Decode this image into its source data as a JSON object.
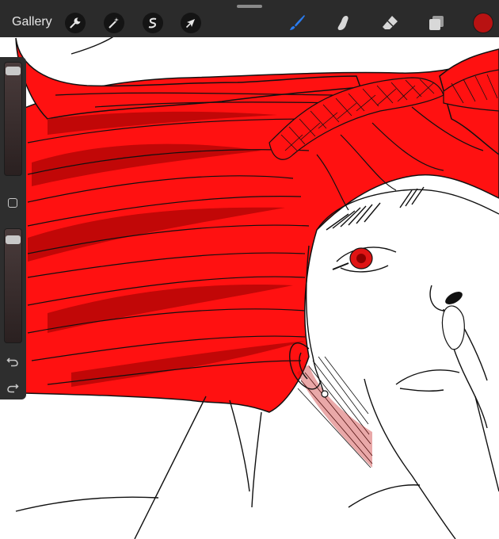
{
  "toolbar": {
    "gallery_label": "Gallery",
    "left_tools": [
      {
        "name": "actions",
        "icon": "wrench-icon"
      },
      {
        "name": "adjustments",
        "icon": "magic-wand-icon"
      },
      {
        "name": "selection",
        "icon": "selection-s-icon"
      },
      {
        "name": "transform",
        "icon": "arrow-cursor-icon"
      }
    ],
    "right_tools": [
      {
        "name": "brush",
        "icon": "brush-icon",
        "active": true
      },
      {
        "name": "smudge",
        "icon": "smudge-finger-icon"
      },
      {
        "name": "eraser",
        "icon": "eraser-icon"
      },
      {
        "name": "layers",
        "icon": "layers-icon"
      }
    ],
    "active_color": "#b81212"
  },
  "sidebar": {
    "brush_size_level": 0.97,
    "opacity_level": 0.95,
    "icons": [
      "modify-square-icon",
      "undo-icon",
      "redo-icon"
    ]
  },
  "canvas": {
    "hair_color": "#ff1111",
    "shadow_color": "#c10707",
    "line_color": "#111111",
    "eye_color": "#e01414"
  }
}
